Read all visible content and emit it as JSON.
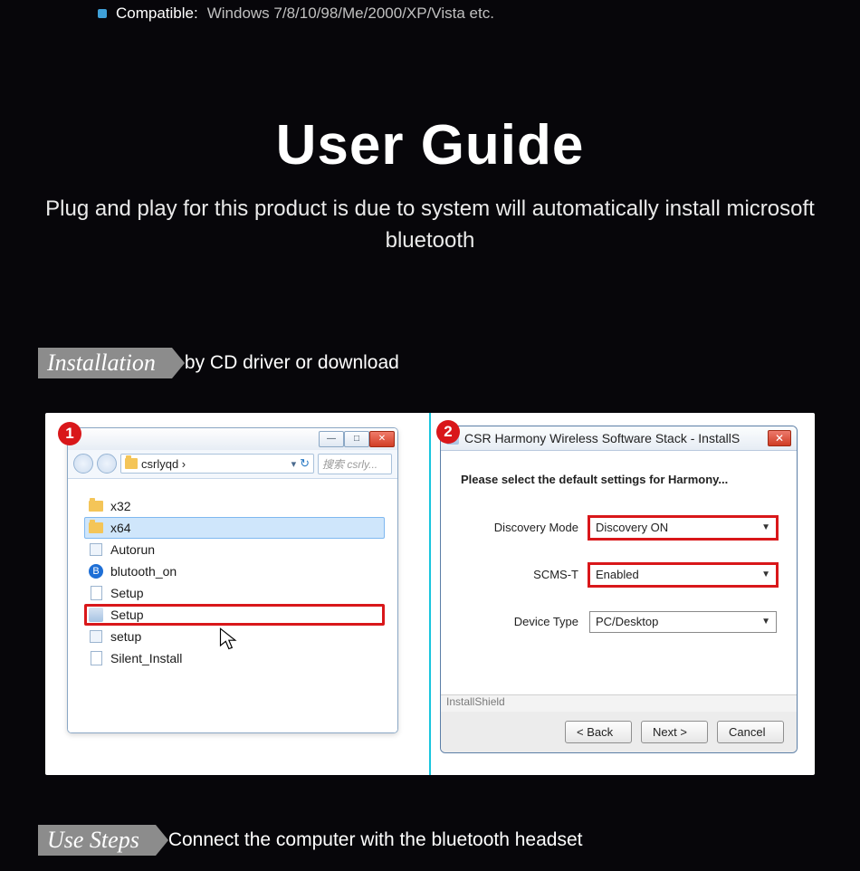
{
  "top": {
    "label": "Compatible:",
    "text": "Windows 7/8/10/98/Me/2000/XP/Vista etc."
  },
  "hero": {
    "title": "User Guide",
    "subtitle": "Plug and play for this product is due to system will automatically install microsoft bluetooth"
  },
  "section_install": {
    "label": "Installation",
    "text": "by CD driver or download"
  },
  "section_use": {
    "label": "Use Steps",
    "text": "Connect the computer with the bluetooth headset"
  },
  "step1": {
    "badge": "1",
    "breadcrumb": "csrlyqd  ›",
    "search_placeholder": "搜索 csrly...",
    "items": {
      "x32": "x32",
      "x64": "x64",
      "autorun": "Autorun",
      "blutooth_on": "blutooth_on",
      "setup_cap": "Setup",
      "setup_main": "Setup",
      "setup_lower": "setup",
      "silent": "Silent_Install"
    }
  },
  "step2": {
    "badge": "2",
    "title": "CSR Harmony Wireless Software Stack - InstallS",
    "heading": "Please select the default settings for Harmony...",
    "rows": {
      "discovery": {
        "label": "Discovery Mode",
        "value": "Discovery ON"
      },
      "scms": {
        "label": "SCMS-T",
        "value": "Enabled"
      },
      "device": {
        "label": "Device Type",
        "value": "PC/Desktop"
      }
    },
    "footer_label": "InstallShield",
    "buttons": {
      "back": "< Back",
      "next": "Next >",
      "cancel": "Cancel"
    }
  }
}
